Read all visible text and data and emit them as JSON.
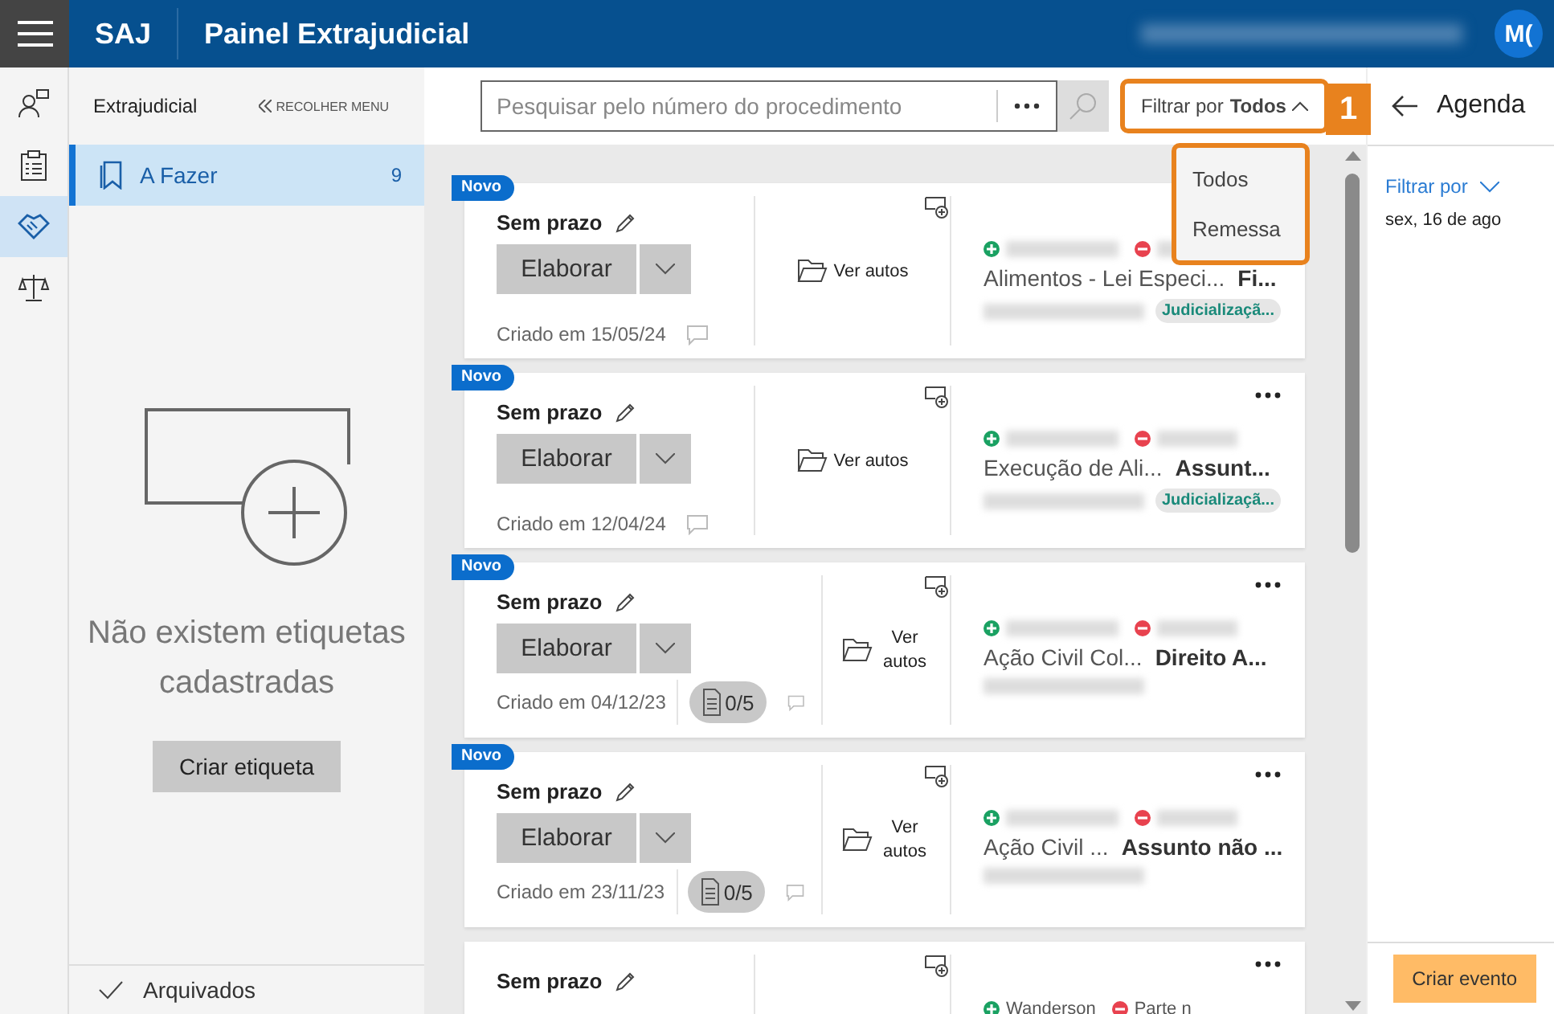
{
  "header": {
    "app": "SAJ",
    "title": "Painel Extrajudicial",
    "avatar": "M("
  },
  "rail": [
    {
      "selected": false
    },
    {
      "selected": false
    },
    {
      "selected": true
    },
    {
      "selected": false
    }
  ],
  "sidebar": {
    "title": "Extrajudicial",
    "collapse": "RECOLHER MENU",
    "items": [
      {
        "label": "A Fazer",
        "count": "9",
        "selected": true
      }
    ],
    "empty_message": "Não existem etiquetas cadastradas",
    "create_button": "Criar etiqueta",
    "footer_item": "Arquivados"
  },
  "toolbar": {
    "search": {
      "placeholder": "Pesquisar pelo número do procedimento"
    },
    "filter": {
      "label": "Filtrar por",
      "value": "Todos",
      "expanded": true,
      "highlighted": true
    },
    "annotation": "1",
    "filter_options": [
      "Todos",
      "Remessa"
    ]
  },
  "cards": [
    {
      "new_badge": "Novo",
      "deadline": "Sem prazo",
      "button": "Elaborar",
      "created": "Criado em 15/05/24",
      "link": "Ver autos",
      "menu": false,
      "class": "Alimentos - Lei Especi...",
      "subject": "Fi...",
      "tag": "Judicializaçã..."
    },
    {
      "new_badge": "Novo",
      "deadline": "Sem prazo",
      "button": "Elaborar",
      "created": "Criado em 12/04/24",
      "link": "Ver autos",
      "menu": true,
      "class": "Execução de Ali...",
      "subject": "Assunt...",
      "tag": "Judicializaçã..."
    },
    {
      "new_badge": "Novo",
      "deadline": "Sem prazo",
      "button": "Elaborar",
      "created": "Criado em 04/12/23",
      "docs": "0/5",
      "link": "Ver autos",
      "menu": true,
      "class": "Ação Civil Col...",
      "subject": "Direito A..."
    },
    {
      "new_badge": "Novo",
      "deadline": "Sem prazo",
      "button": "Elaborar",
      "created": "Criado em 23/11/23",
      "docs": "0/5",
      "link": "Ver autos",
      "menu": true,
      "class": "Ação Civil ...",
      "subject": "Assunto não ..."
    },
    {
      "deadline": "Sem prazo",
      "menu": true,
      "plus_party": "Wanderson",
      "minus_party": "Parte n"
    }
  ],
  "agenda": {
    "title": "Agenda",
    "filter": "Filtrar por",
    "date": "sex, 16 de ago",
    "create_button": "Criar evento"
  }
}
